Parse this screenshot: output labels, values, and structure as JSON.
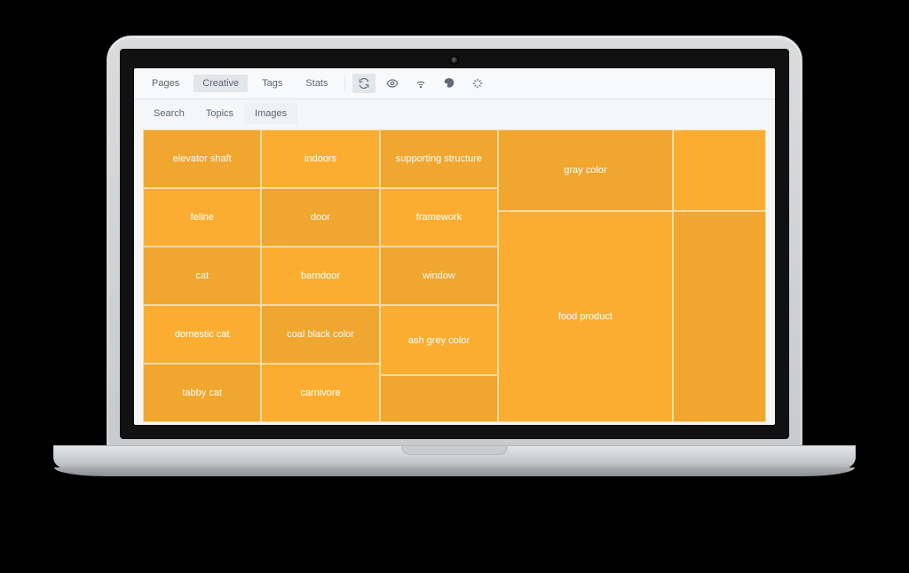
{
  "toolbar": {
    "tabs": [
      "Pages",
      "Creative",
      "Tags",
      "Stats"
    ],
    "active_tab_index": 1,
    "icons": [
      "refresh-icon",
      "eye-icon",
      "wifi-icon",
      "paint-icon",
      "sparkle-icon"
    ],
    "active_icon_index": 0
  },
  "subtabs": {
    "tabs": [
      "Search",
      "Topics",
      "Images"
    ],
    "active_index": 2
  },
  "treemap": {
    "cells": {
      "c0": "elevator shaft",
      "c1": "indoors",
      "c2": "supporting structure",
      "c3": "feline",
      "c4": "door",
      "c5": "framework",
      "c6": "cat",
      "c7": "barndoor",
      "c8": "window",
      "c9": "domestic cat",
      "c10": "coal black color",
      "c11": "tabby cat",
      "c12": "carnivore",
      "c13": "ash grey color",
      "c14": "gray color",
      "c15": "food product",
      "c16": "",
      "c17": ""
    }
  }
}
